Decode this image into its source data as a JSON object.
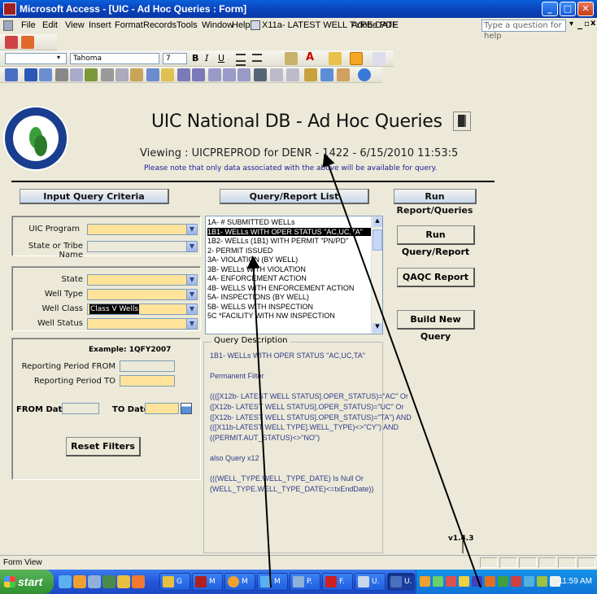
{
  "window": {
    "title": "Microsoft Access - [UIC - Ad Hoc Queries : Form]",
    "minimize_glyph": "_",
    "maximize_glyph": "□",
    "close_glyph": "✕"
  },
  "menu": {
    "items": [
      "File",
      "Edit",
      "View",
      "Insert",
      "Format",
      "Records",
      "Tools",
      "Window",
      "Help",
      "X11a- LATEST WELL TYPE DATE",
      "Adobe PDF"
    ],
    "help_placeholder": "Type a question for help"
  },
  "formatting": {
    "font_name": "Tahoma",
    "font_size": "7",
    "bold": "B",
    "italic": "I",
    "underline": "U"
  },
  "header": {
    "title": "UIC National DB - Ad Hoc Queries",
    "viewing": "Viewing : UICPREPROD for DENR - 1422 - 6/15/2010 11:53:5",
    "note": "Please note that only data associated with the above will be available for query."
  },
  "sections": {
    "input_criteria": "Input Query Criteria",
    "query_list": "Query/Report List",
    "run_reports": "Run Report/Queries"
  },
  "criteria": {
    "uic_program_label": "UIC Program",
    "state_tribe_label": "State or Tribe Name",
    "state_label": "State",
    "well_type_label": "Well Type",
    "well_class_label": "Well Class",
    "well_class_value": "Class V Wells",
    "well_status_label": "Well Status"
  },
  "reporting": {
    "example": "Example: 1QFY2007",
    "from_label": "Reporting Period FROM",
    "to_label": "Reporting Period TO",
    "from_date_label": "FROM Date",
    "to_date_label": "TO Date",
    "reset_button": "Reset Filters"
  },
  "query_list": [
    "1A- # SUBMITTED WELLs",
    "1B1- WELLs WITH OPER STATUS \"AC,UC,TA\"",
    "1B2- WELLs (1B1) WITH PERMIT \"PN/PD\"",
    "2- PERMIT ISSUED",
    "3A- VIOLATION (BY WELL)",
    "3B- WELLs WITH VIOLATION",
    "4A- ENFORCEMENT ACTION",
    "4B- WELLS WITH ENFORCEMENT ACTION",
    "5A- INSPECTIONS (BY WELL)",
    "5B- WELLS WITH INSPECTION",
    "5C *FACILITY WITH NW INSPECTION"
  ],
  "selected_query_index": 1,
  "description": {
    "legend": "Query Description",
    "lines": [
      "1B1- WELLs WITH OPER STATUS \"AC,UC,TA\"",
      "",
      "Permanent Filter",
      "",
      "((([X12b- LATEST WELL STATUS].OPER_STATUS)=\"AC\" Or",
      "([X12b- LATEST WELL STATUS].OPER_STATUS)=\"UC\" Or",
      "([X12b- LATEST WELL STATUS].OPER_STATUS)=\"TA\") AND",
      "(([X11b-LATEST WELL TYPE].WELL_TYPE)<>\"CY\") AND",
      "((PERMIT.AUT_STATUS)<>\"NO\")",
      "",
      "also Query x12",
      "",
      "(((WELL_TYPE.WELL_TYPE_DATE) Is Null Or",
      "(WELL_TYPE.WELL_TYPE_DATE)<=txEndDate))"
    ]
  },
  "actions": {
    "run_query": "Run Query/Report",
    "qaqc": "QAQC Report",
    "build_query": "Build New Query"
  },
  "version": "v1.4.3",
  "status_bar": {
    "text": "Form View"
  },
  "taskbar": {
    "start": "start",
    "tasks": [
      "G",
      "M",
      "M",
      "M",
      "P.",
      "F.",
      "U.",
      "U."
    ],
    "clock": "11:59 AM"
  }
}
